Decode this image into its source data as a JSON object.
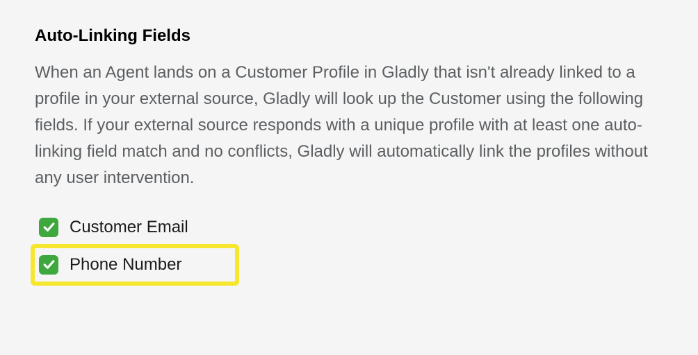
{
  "section": {
    "title": "Auto-Linking Fields",
    "description": "When an Agent lands on a Customer Profile in Gladly that isn't already linked to a profile in your external source, Gladly will look up the Customer using the following fields. If your external source responds with a unique profile with at least one auto-linking field match and no conflicts, Gladly will automatically link the profiles without any user intervention."
  },
  "fields": [
    {
      "label": "Customer Email",
      "checked": true,
      "highlighted": false
    },
    {
      "label": "Phone Number",
      "checked": true,
      "highlighted": true
    }
  ]
}
